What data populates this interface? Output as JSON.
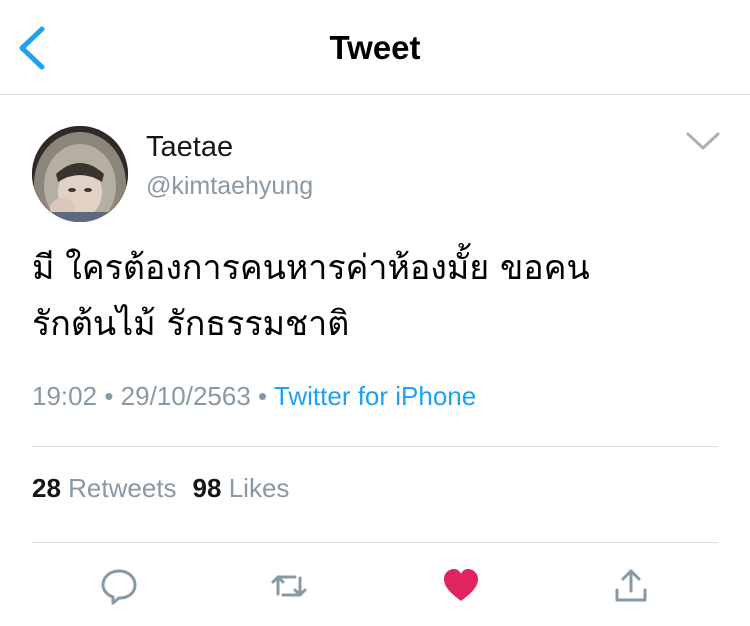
{
  "header": {
    "title": "Tweet",
    "back_icon": "chevron-left-icon"
  },
  "tweet": {
    "author": {
      "name": "Taetae",
      "handle": "@kimtaehyung"
    },
    "text_line1": "มี ใครต้องการคนหารค่าห้องมั้ย ขอคน",
    "text_line2": "รักต้นไม้ รักธรรมชาติ",
    "time": "19:02",
    "date": "29/10/2563",
    "separator": "•",
    "source": "Twitter for iPhone",
    "stats": {
      "retweets": "28",
      "retweets_label": "Retweets",
      "likes": "98",
      "likes_label": "Likes"
    }
  },
  "actions": [
    {
      "name": "reply",
      "icon": "reply-icon"
    },
    {
      "name": "retweet",
      "icon": "retweet-icon"
    },
    {
      "name": "like",
      "icon": "heart-icon",
      "active": true
    },
    {
      "name": "share",
      "icon": "share-icon"
    }
  ],
  "colors": {
    "accent": "#1da1f2",
    "like": "#e0245e",
    "secondary_text": "#8899a6",
    "primary_text": "#14171a"
  }
}
